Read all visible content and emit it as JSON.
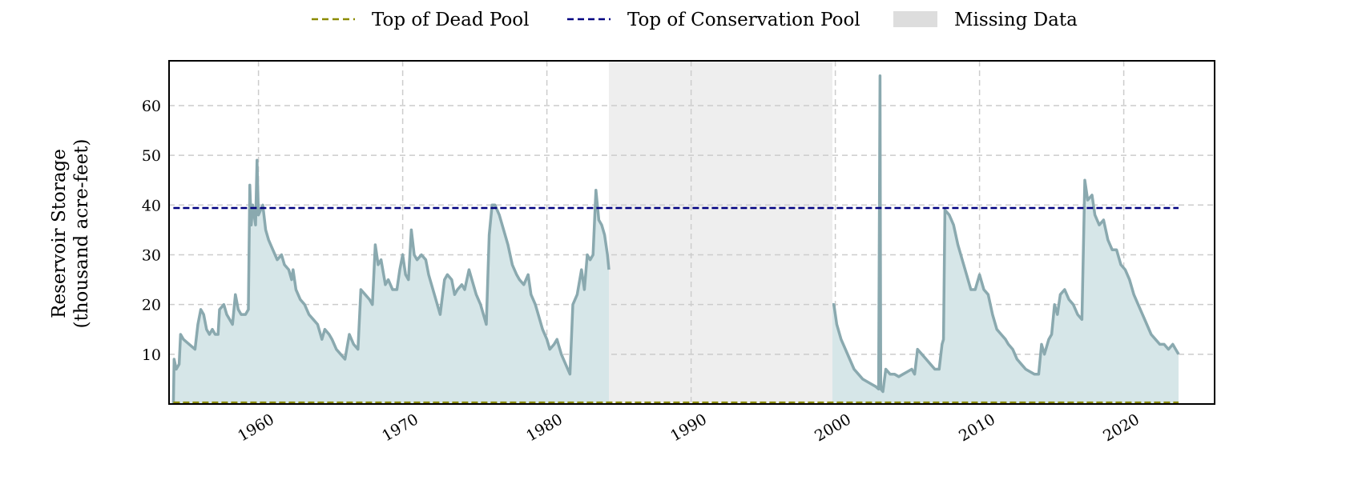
{
  "chart_data": {
    "type": "area",
    "ylabel_line1": "Reservoir Storage",
    "ylabel_line2": "(thousand acre-feet)",
    "xlim": [
      1953.8,
      2026.3
    ],
    "ylim": [
      0,
      69
    ],
    "x_ticks": [
      1960,
      1970,
      1980,
      1990,
      2000,
      2010,
      2020
    ],
    "y_ticks": [
      10,
      20,
      30,
      40,
      50,
      60
    ],
    "grid": true,
    "legend_position": "top-center",
    "legend": {
      "dead_pool": "Top of Dead Pool",
      "conservation_pool": "Top of Conservation Pool",
      "missing": "Missing Data"
    },
    "reference_lines": {
      "dead_pool": 0.3,
      "conservation_pool": 39.4
    },
    "missing_range": [
      1984.3,
      1999.8
    ],
    "colors": {
      "series_line": "#8aa9af",
      "series_fill": "#d6e6e8",
      "dead_pool": "#8b8b00",
      "conservation_pool": "#000080",
      "missing": "#eeeeee",
      "grid": "#cccccc"
    },
    "series": [
      {
        "segments": [
          [
            [
              1954.1,
              0
            ],
            [
              1954.15,
              9
            ],
            [
              1954.3,
              7
            ],
            [
              1954.5,
              8
            ],
            [
              1954.6,
              14
            ],
            [
              1954.8,
              13
            ],
            [
              1955.2,
              12
            ],
            [
              1955.6,
              11
            ],
            [
              1955.8,
              16
            ],
            [
              1956.0,
              19
            ],
            [
              1956.2,
              18
            ],
            [
              1956.4,
              15
            ],
            [
              1956.6,
              14
            ],
            [
              1956.8,
              15
            ],
            [
              1957.0,
              14
            ],
            [
              1957.2,
              14
            ],
            [
              1957.3,
              19
            ],
            [
              1957.6,
              20
            ],
            [
              1957.8,
              18
            ],
            [
              1958.0,
              17
            ],
            [
              1958.2,
              16
            ],
            [
              1958.4,
              22
            ],
            [
              1958.6,
              19
            ],
            [
              1958.8,
              18
            ],
            [
              1959.1,
              18
            ],
            [
              1959.3,
              19
            ],
            [
              1959.4,
              44
            ],
            [
              1959.5,
              36
            ],
            [
              1959.6,
              40
            ],
            [
              1959.8,
              36
            ],
            [
              1959.9,
              49
            ],
            [
              1960.0,
              38
            ],
            [
              1960.3,
              40
            ],
            [
              1960.5,
              35
            ],
            [
              1960.7,
              33
            ],
            [
              1961.0,
              31
            ],
            [
              1961.3,
              29
            ],
            [
              1961.6,
              30
            ],
            [
              1961.8,
              28
            ],
            [
              1962.1,
              27
            ],
            [
              1962.3,
              25
            ],
            [
              1962.4,
              27
            ],
            [
              1962.6,
              23
            ],
            [
              1962.9,
              21
            ],
            [
              1963.2,
              20
            ],
            [
              1963.5,
              18
            ],
            [
              1963.8,
              17
            ],
            [
              1964.1,
              16
            ],
            [
              1964.4,
              13
            ],
            [
              1964.6,
              15
            ],
            [
              1964.9,
              14
            ],
            [
              1965.1,
              13
            ],
            [
              1965.4,
              11
            ],
            [
              1965.7,
              10
            ],
            [
              1966.0,
              9
            ],
            [
              1966.3,
              14
            ],
            [
              1966.6,
              12
            ],
            [
              1966.9,
              11
            ],
            [
              1967.1,
              23
            ],
            [
              1967.4,
              22
            ],
            [
              1967.7,
              21
            ],
            [
              1967.9,
              20
            ],
            [
              1968.1,
              32
            ],
            [
              1968.3,
              28
            ],
            [
              1968.5,
              29
            ],
            [
              1968.8,
              24
            ],
            [
              1969.0,
              25
            ],
            [
              1969.3,
              23
            ],
            [
              1969.6,
              23
            ],
            [
              1969.8,
              27
            ],
            [
              1970.0,
              30
            ],
            [
              1970.2,
              26
            ],
            [
              1970.4,
              25
            ],
            [
              1970.6,
              35
            ],
            [
              1970.8,
              30
            ],
            [
              1971.0,
              29
            ],
            [
              1971.3,
              30
            ],
            [
              1971.6,
              29
            ],
            [
              1971.8,
              26
            ],
            [
              1972.1,
              23
            ],
            [
              1972.4,
              20
            ],
            [
              1972.6,
              18
            ],
            [
              1972.9,
              25
            ],
            [
              1973.1,
              26
            ],
            [
              1973.4,
              25
            ],
            [
              1973.6,
              22
            ],
            [
              1973.8,
              23
            ],
            [
              1974.1,
              24
            ],
            [
              1974.3,
              23
            ],
            [
              1974.6,
              27
            ],
            [
              1974.8,
              25
            ],
            [
              1975.1,
              22
            ],
            [
              1975.4,
              20
            ],
            [
              1975.6,
              18
            ],
            [
              1975.8,
              16
            ],
            [
              1976.0,
              34
            ],
            [
              1976.2,
              40
            ],
            [
              1976.4,
              40
            ],
            [
              1976.7,
              38
            ],
            [
              1977.0,
              35
            ],
            [
              1977.3,
              32
            ],
            [
              1977.6,
              28
            ],
            [
              1977.9,
              26
            ],
            [
              1978.1,
              25
            ],
            [
              1978.4,
              24
            ],
            [
              1978.7,
              26
            ],
            [
              1978.9,
              22
            ],
            [
              1979.2,
              20
            ],
            [
              1979.5,
              17
            ],
            [
              1979.7,
              15
            ],
            [
              1980.0,
              13
            ],
            [
              1980.2,
              11
            ],
            [
              1980.5,
              12
            ],
            [
              1980.7,
              13
            ],
            [
              1981.0,
              10
            ],
            [
              1981.3,
              8
            ],
            [
              1981.6,
              6
            ],
            [
              1981.8,
              20
            ],
            [
              1982.1,
              22
            ],
            [
              1982.4,
              27
            ],
            [
              1982.6,
              23
            ],
            [
              1982.8,
              30
            ],
            [
              1983.0,
              29
            ],
            [
              1983.2,
              30
            ],
            [
              1983.4,
              43
            ],
            [
              1983.6,
              37
            ],
            [
              1983.8,
              36
            ],
            [
              1984.0,
              34
            ],
            [
              1984.2,
              30
            ],
            [
              1984.3,
              27
            ]
          ],
          [
            [
              1999.8,
              20
            ],
            [
              1999.9,
              20
            ],
            [
              2000.1,
              16
            ],
            [
              2000.4,
              13
            ],
            [
              2000.7,
              11
            ],
            [
              2001.0,
              9
            ],
            [
              2001.3,
              7
            ],
            [
              2001.6,
              6
            ],
            [
              2001.9,
              5
            ],
            [
              2002.2,
              4.5
            ],
            [
              2002.5,
              4
            ],
            [
              2002.8,
              3.5
            ],
            [
              2003.0,
              3
            ],
            [
              2003.1,
              66
            ],
            [
              2003.15,
              3
            ],
            [
              2003.3,
              2.5
            ],
            [
              2003.5,
              7
            ],
            [
              2003.8,
              6
            ],
            [
              2004.1,
              6
            ],
            [
              2004.4,
              5.5
            ],
            [
              2004.7,
              6
            ],
            [
              2005.0,
              6.5
            ],
            [
              2005.3,
              7
            ],
            [
              2005.5,
              6
            ],
            [
              2005.7,
              11
            ],
            [
              2006.0,
              10
            ],
            [
              2006.3,
              9
            ],
            [
              2006.6,
              8
            ],
            [
              2006.9,
              7
            ],
            [
              2007.2,
              7
            ],
            [
              2007.4,
              12
            ],
            [
              2007.5,
              13
            ],
            [
              2007.6,
              39
            ],
            [
              2007.9,
              38
            ],
            [
              2008.2,
              36
            ],
            [
              2008.5,
              32
            ],
            [
              2008.8,
              29
            ],
            [
              2009.1,
              26
            ],
            [
              2009.4,
              23
            ],
            [
              2009.7,
              23
            ],
            [
              2010.0,
              26
            ],
            [
              2010.3,
              23
            ],
            [
              2010.6,
              22
            ],
            [
              2010.9,
              18
            ],
            [
              2011.2,
              15
            ],
            [
              2011.5,
              14
            ],
            [
              2011.8,
              13
            ],
            [
              2012.0,
              12
            ],
            [
              2012.3,
              11
            ],
            [
              2012.6,
              9
            ],
            [
              2012.9,
              8
            ],
            [
              2013.2,
              7
            ],
            [
              2013.5,
              6.5
            ],
            [
              2013.8,
              6
            ],
            [
              2014.1,
              6
            ],
            [
              2014.3,
              12
            ],
            [
              2014.5,
              10
            ],
            [
              2014.8,
              13
            ],
            [
              2015.0,
              14
            ],
            [
              2015.2,
              20
            ],
            [
              2015.4,
              18
            ],
            [
              2015.6,
              22
            ],
            [
              2015.9,
              23
            ],
            [
              2016.2,
              21
            ],
            [
              2016.5,
              20
            ],
            [
              2016.8,
              18
            ],
            [
              2017.1,
              17
            ],
            [
              2017.3,
              45
            ],
            [
              2017.5,
              41
            ],
            [
              2017.8,
              42
            ],
            [
              2018.0,
              38
            ],
            [
              2018.3,
              36
            ],
            [
              2018.6,
              37
            ],
            [
              2018.9,
              33
            ],
            [
              2019.2,
              31
            ],
            [
              2019.5,
              31
            ],
            [
              2019.8,
              28
            ],
            [
              2020.1,
              27
            ],
            [
              2020.4,
              25
            ],
            [
              2020.7,
              22
            ],
            [
              2021.0,
              20
            ],
            [
              2021.3,
              18
            ],
            [
              2021.6,
              16
            ],
            [
              2021.9,
              14
            ],
            [
              2022.2,
              13
            ],
            [
              2022.5,
              12
            ],
            [
              2022.8,
              12
            ],
            [
              2023.1,
              11
            ],
            [
              2023.4,
              12
            ],
            [
              2023.6,
              11
            ],
            [
              2023.8,
              10
            ]
          ]
        ]
      }
    ]
  }
}
